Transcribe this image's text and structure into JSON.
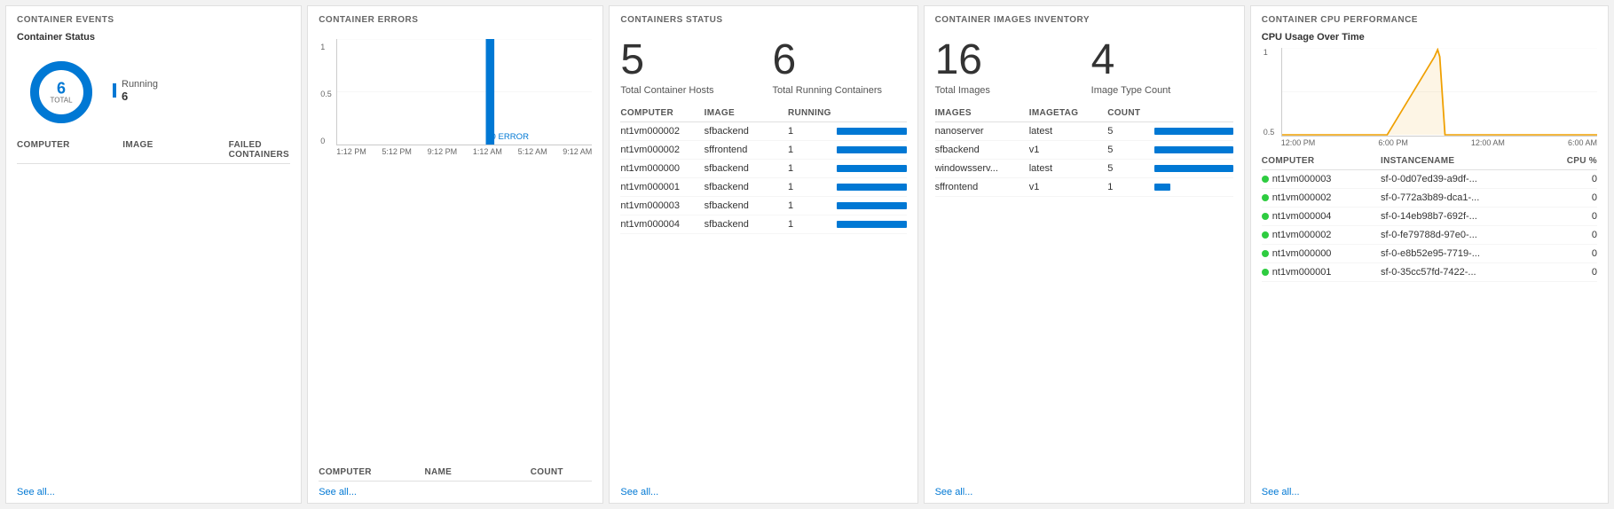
{
  "panels": {
    "events": {
      "title": "CONTAINER EVENTS",
      "subtitle": "Container Status",
      "donut": {
        "total": "6",
        "label": "TOTAL",
        "running_label": "Running",
        "running_value": "6"
      },
      "table": {
        "headers": [
          "COMPUTER",
          "IMAGE",
          "FAILED CONTAINERS"
        ],
        "rows": []
      },
      "see_all": "See all..."
    },
    "errors": {
      "title": "CONTAINER ERRORS",
      "y_labels": [
        "1",
        "0.5",
        "0"
      ],
      "x_labels": [
        "1:12 PM",
        "5:12 PM",
        "9:12 PM",
        "1:12 AM",
        "5:12 AM",
        "9:12 AM"
      ],
      "error_label": "0 ERROR",
      "table": {
        "headers": [
          "COMPUTER",
          "NAME",
          "COUNT"
        ],
        "rows": []
      },
      "see_all": "See all..."
    },
    "status": {
      "title": "CONTAINERS STATUS",
      "stats": [
        {
          "number": "5",
          "label": "Total Container Hosts"
        },
        {
          "number": "6",
          "label": "Total Running Containers"
        }
      ],
      "table": {
        "headers": [
          "COMPUTER",
          "IMAGE",
          "RUNNING"
        ],
        "rows": [
          {
            "computer": "nt1vm000002",
            "image": "sfbackend",
            "running": "1",
            "bar_pct": 100
          },
          {
            "computer": "nt1vm000002",
            "image": "sffrontend",
            "running": "1",
            "bar_pct": 100
          },
          {
            "computer": "nt1vm000000",
            "image": "sfbackend",
            "running": "1",
            "bar_pct": 100
          },
          {
            "computer": "nt1vm000001",
            "image": "sfbackend",
            "running": "1",
            "bar_pct": 100
          },
          {
            "computer": "nt1vm000003",
            "image": "sfbackend",
            "running": "1",
            "bar_pct": 100
          },
          {
            "computer": "nt1vm000004",
            "image": "sfbackend",
            "running": "1",
            "bar_pct": 100
          }
        ]
      },
      "see_all": "See all..."
    },
    "inventory": {
      "title": "CONTAINER IMAGES INVENTORY",
      "stats": [
        {
          "number": "16",
          "label": "Total Images"
        },
        {
          "number": "4",
          "label": "Image Type Count"
        }
      ],
      "table": {
        "headers": [
          "IMAGES",
          "IMAGETAG",
          "COUNT"
        ],
        "rows": [
          {
            "images": "nanoserver",
            "imagetag": "latest",
            "count": "5",
            "bar_pct": 100
          },
          {
            "images": "sfbackend",
            "imagetag": "v1",
            "count": "5",
            "bar_pct": 100
          },
          {
            "images": "windowsserv...",
            "imagetag": "latest",
            "count": "5",
            "bar_pct": 100
          },
          {
            "images": "sffrontend",
            "imagetag": "v1",
            "count": "1",
            "bar_pct": 20
          }
        ]
      },
      "see_all": "See all..."
    },
    "cpu": {
      "title": "CONTAINER CPU PERFORMANCE",
      "chart_title": "CPU Usage Over Time",
      "y_labels": [
        "1",
        "0.5"
      ],
      "x_labels": [
        "12:00 PM",
        "6:00 PM",
        "12:00 AM",
        "6:00 AM"
      ],
      "table": {
        "headers": [
          "COMPUTER",
          "INSTANCENAME",
          "CPU %"
        ],
        "rows": [
          {
            "computer": "nt1vm000003",
            "instance": "sf-0-0d07ed39-a9df-...",
            "cpu": "0"
          },
          {
            "computer": "nt1vm000002",
            "instance": "sf-0-772a3b89-dca1-...",
            "cpu": "0"
          },
          {
            "computer": "nt1vm000004",
            "instance": "sf-0-14eb98b7-692f-...",
            "cpu": "0"
          },
          {
            "computer": "nt1vm000002",
            "instance": "sf-0-fe79788d-97e0-...",
            "cpu": "0"
          },
          {
            "computer": "nt1vm000000",
            "instance": "sf-0-e8b52e95-7719-...",
            "cpu": "0"
          },
          {
            "computer": "nt1vm000001",
            "instance": "sf-0-35cc57fd-7422-...",
            "cpu": "0"
          }
        ]
      },
      "see_all": "See all..."
    }
  }
}
